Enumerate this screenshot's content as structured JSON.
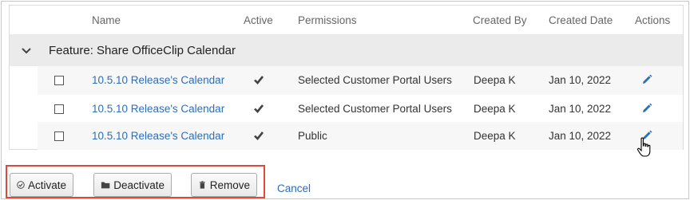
{
  "columns": {
    "name": "Name",
    "active": "Active",
    "permissions": "Permissions",
    "created_by": "Created By",
    "created_date": "Created Date",
    "actions": "Actions"
  },
  "group": {
    "label": "Feature: Share OfficeClip Calendar",
    "expanded": true
  },
  "rows": [
    {
      "name": "10.5.10 Release's Calendar",
      "active": true,
      "permissions": "Selected Customer Portal Users",
      "created_by": "Deepa K",
      "created_date": "Jan 10, 2022"
    },
    {
      "name": "10.5.10 Release's Calendar",
      "active": true,
      "permissions": "Selected Customer Portal Users",
      "created_by": "Deepa K",
      "created_date": "Jan 10, 2022"
    },
    {
      "name": "10.5.10 Release's Calendar",
      "active": true,
      "permissions": "Public",
      "created_by": "Deepa K",
      "created_date": "Jan 10, 2022"
    }
  ],
  "buttons": {
    "activate": "Activate",
    "deactivate": "Deactivate",
    "remove": "Remove",
    "cancel": "Cancel"
  },
  "icons": {
    "row_action": "pencil-icon",
    "active": "checkmark-icon",
    "expand": "chevron-down-icon",
    "activate": "check-circle-icon",
    "deactivate": "folder-icon",
    "remove": "trash-icon",
    "cursor": "hand-pointer-icon"
  },
  "colors": {
    "link": "#2a6ebb",
    "highlight_border": "#e0483a",
    "group_bg": "#ebebeb",
    "alt_row_bg": "#f7f7f7"
  }
}
